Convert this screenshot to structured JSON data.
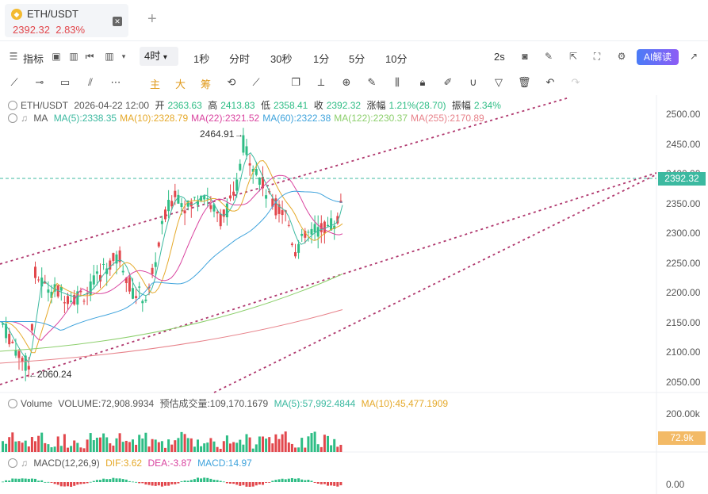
{
  "tab": {
    "title": "ETH/USDT",
    "price": "2392.32",
    "change": "2.83%",
    "close_icon": "close-icon",
    "add_icon": "plus-icon"
  },
  "toolbar1": {
    "indicators_label": "指标",
    "active_interval": "4时",
    "intervals": [
      "1秒",
      "分时",
      "30秒",
      "1分",
      "5分",
      "10分"
    ],
    "refresh_label": "2s",
    "ai_label": "AI解读"
  },
  "toolbar2": {
    "cn_items": [
      "主",
      "大",
      "筹"
    ]
  },
  "info": {
    "symbol": "ETH/USDT",
    "datetime": "2026-04-22 12:00",
    "open_label": "开",
    "open": "2363.63",
    "high_label": "高",
    "high": "2413.83",
    "low_label": "低",
    "low": "2358.41",
    "close_label": "收",
    "close": "2392.32",
    "change_label": "涨幅",
    "change": "1.21%(28.70)",
    "amplitude_label": "振幅",
    "amplitude": "2.34%"
  },
  "ma": {
    "label": "MA",
    "items": [
      {
        "text": "MA(5):2338.35",
        "color": "#3cb9a0"
      },
      {
        "text": "MA(10):2328.79",
        "color": "#e5a92a"
      },
      {
        "text": "MA(22):2321.52",
        "color": "#d9439f"
      },
      {
        "text": "MA(60):2322.38",
        "color": "#3fa3dc"
      },
      {
        "text": "MA(122):2230.37",
        "color": "#8ccf6c"
      },
      {
        "text": "MA(255):2170.89",
        "color": "#e7828a"
      }
    ]
  },
  "volume": {
    "label": "Volume",
    "value": "VOLUME:72,908.9934",
    "estimate": "预估成交量:109,170.1679",
    "ma5": "MA(5):57,992.4844",
    "ma10": "MA(10):45,477.1909",
    "axis_label": "200.00k",
    "tag": "72.9k"
  },
  "macd": {
    "label": "MACD(12,26,9)",
    "dif": "DIF:3.62",
    "dea": "DEA:-3.87",
    "macd": "MACD:14.97",
    "axis_label": "0.00"
  },
  "price_axis": [
    "2500.00",
    "2450.00",
    "2400.00",
    "2350.00",
    "2300.00",
    "2250.00",
    "2200.00",
    "2150.00",
    "2100.00",
    "2050.00"
  ],
  "current_price_tag": "2392.32",
  "annotations": {
    "high": "2464.91",
    "low": "2060.24"
  },
  "colors": {
    "up": "#2ebd85",
    "down": "#e2474c",
    "accent": "#e09a1b"
  }
}
